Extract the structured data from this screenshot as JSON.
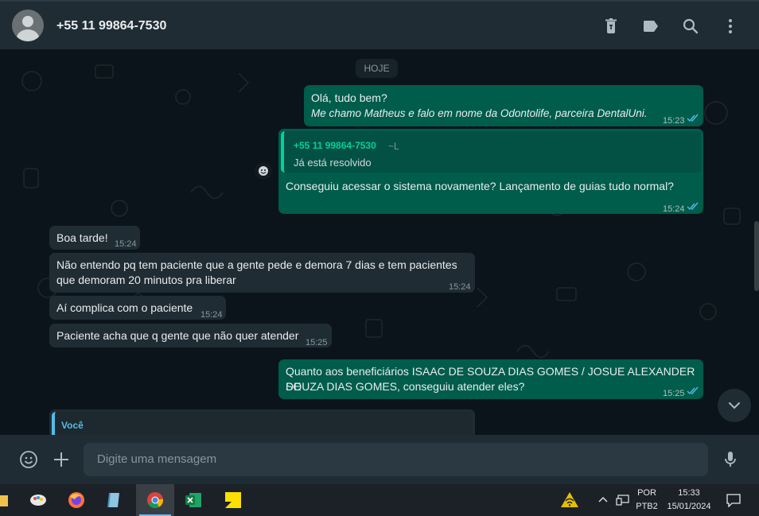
{
  "header": {
    "contact_name": "+55 11 99864-7530"
  },
  "chat": {
    "date_chip": "HOJE",
    "messages": [
      {
        "line1": "Olá, tudo bem?",
        "line2": "Me chamo Matheus e falo em nome da Odontolife, parceira DentalUni.",
        "time": "15:23"
      },
      {
        "quote_author": "+55 11 99864-7530",
        "quote_tag": "~L",
        "quote_text": "Já está resolvido",
        "text": "Conseguiu acessar o sistema novamente? Lançamento de guias tudo normal?",
        "time": "15:24"
      },
      {
        "text": "Boa tarde!",
        "time": "15:24"
      },
      {
        "line1": "Não entendo pq tem paciente que a gente pede e demora 7 dias e tem pacientes",
        "line2": "que demoram 20 minutos pra liberar",
        "time": "15:24"
      },
      {
        "text": "Aí complica com o paciente",
        "time": "15:24"
      },
      {
        "text": "Paciente acha que q gente que não quer atender",
        "time": "15:25"
      },
      {
        "line1": "Quanto aos beneficiários ISAAC DE SOUZA DIAS GOMES / JOSUE ALEXANDER DE",
        "line2": "SOUZA DIAS GOMES, conseguiu atender eles?",
        "time": "15:25"
      },
      {
        "quote_author": "Você"
      }
    ]
  },
  "footer": {
    "placeholder": "Digite uma mensagem"
  },
  "taskbar": {
    "lang_top": "POR",
    "lang_bottom": "PTB2",
    "clock_time": "15:33",
    "clock_date": "15/01/2024"
  },
  "colors": {
    "accent": "#06cf9c",
    "outgoing_bubble": "#005c4b",
    "incoming_bubble": "#202c33",
    "read_ticks": "#53bdeb"
  }
}
